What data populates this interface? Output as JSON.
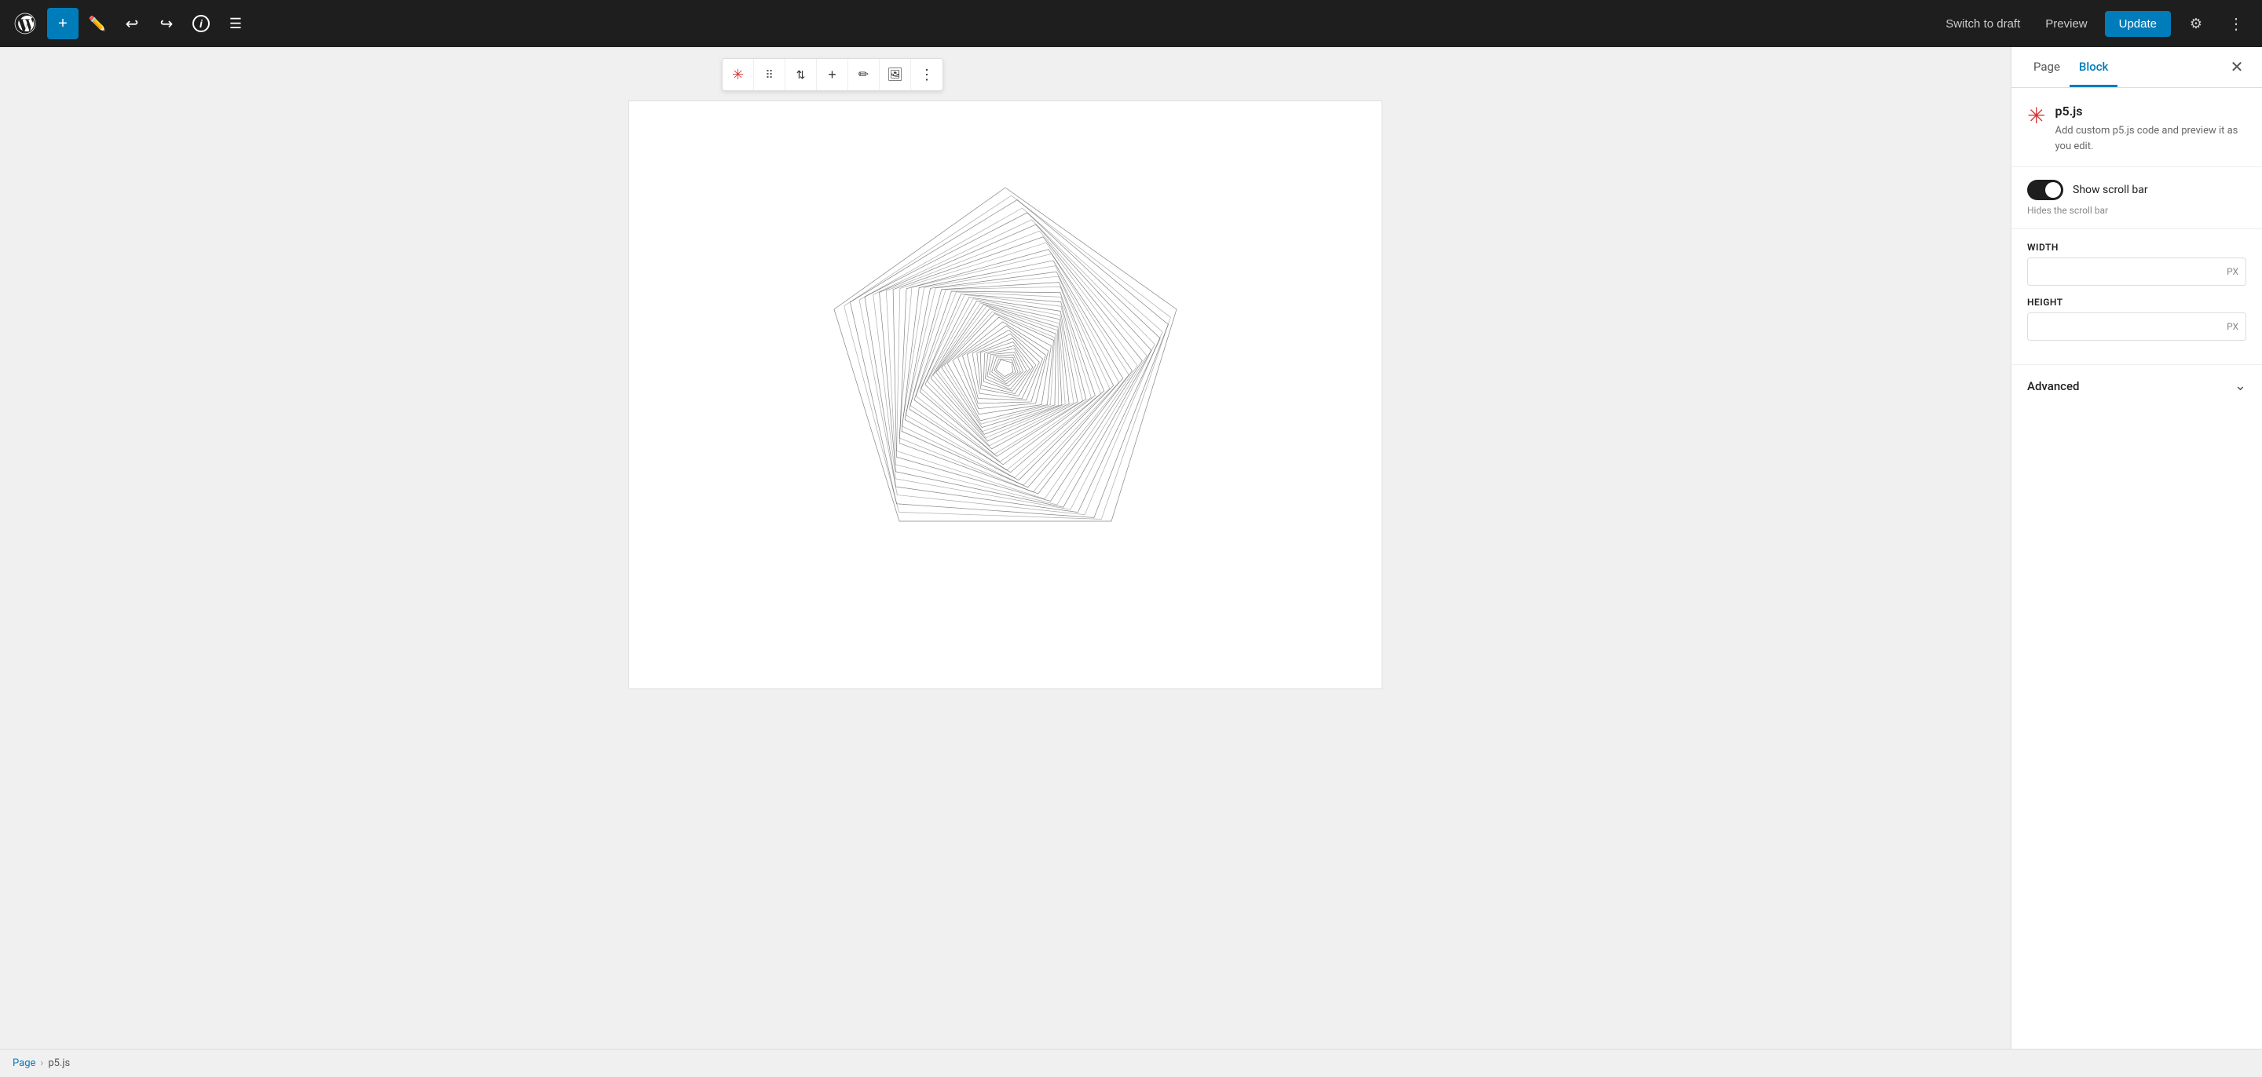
{
  "topbar": {
    "add_label": "+",
    "switch_draft_label": "Switch to draft",
    "preview_label": "Preview",
    "update_label": "Update"
  },
  "block_toolbar": {
    "icon_asterisk": "✳",
    "move_icon": "⠿",
    "arrows_icon": "⇅",
    "add_icon": "+",
    "edit_icon": "✏",
    "image_icon": "🖼",
    "more_icon": "⋮"
  },
  "right_panel": {
    "tab_page": "Page",
    "tab_block": "Block",
    "active_tab": "Block",
    "close_icon": "✕",
    "block_name": "p5.js",
    "block_description": "Add custom p5.js code and preview it as you edit.",
    "show_scroll_bar_label": "Show scroll bar",
    "show_scroll_bar_hint": "Hides the scroll bar",
    "toggle_on": true,
    "width_label": "WIDTH",
    "width_value": "",
    "width_unit": "PX",
    "height_label": "HEIGHT",
    "height_value": "",
    "height_unit": "PX",
    "advanced_label": "Advanced",
    "chevron_icon": "⌄"
  },
  "status_bar": {
    "page_label": "Page",
    "separator": "›",
    "current_page": "p5.js"
  }
}
